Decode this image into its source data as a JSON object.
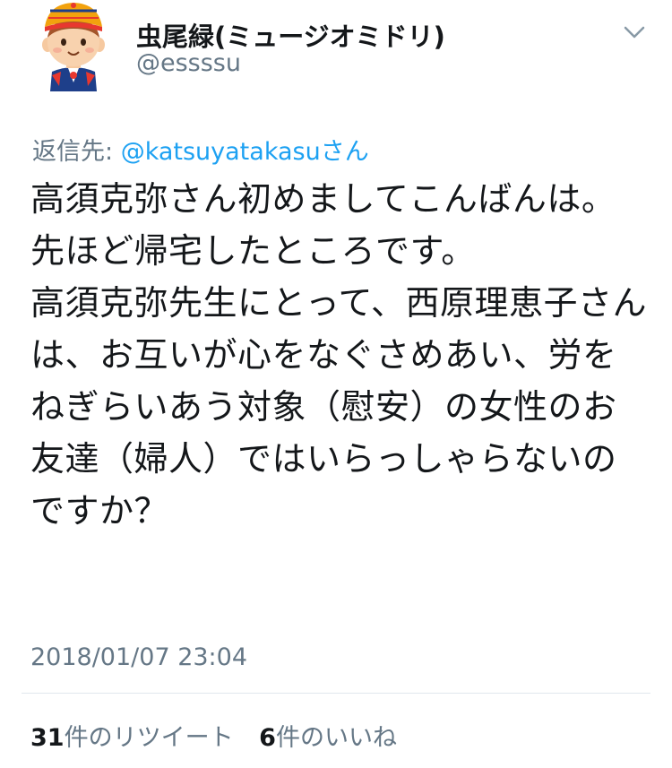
{
  "user": {
    "display_name": "虫尾緑(ミュージオミドリ)",
    "handle": "@essssu"
  },
  "reply": {
    "prefix": "返信先: ",
    "mention": "@katsuyatakasuさん"
  },
  "tweet": {
    "text": "高須克弥さん初めましてこんばんは。\n先ほど帰宅したところです。\n高須克弥先生にとって、西原理恵子さんは、お互いが心をなぐさめあい、労をねぎらいあう対象（慰安）の女性のお友達（婦人）ではいらっしゃらないのですか？",
    "timestamp": "2018/01/07 23:04"
  },
  "stats": {
    "retweets_count": "31",
    "retweets_label": "件のリツイート",
    "likes_count": "6",
    "likes_label": "件のいいね"
  },
  "icons": {
    "avatar": "cartoon-boy-avatar-icon",
    "menu": "chevron-down-icon"
  },
  "colors": {
    "text": "#14171a",
    "secondary": "#657786",
    "link": "#1da1f2",
    "divider": "#e1e8ed"
  }
}
